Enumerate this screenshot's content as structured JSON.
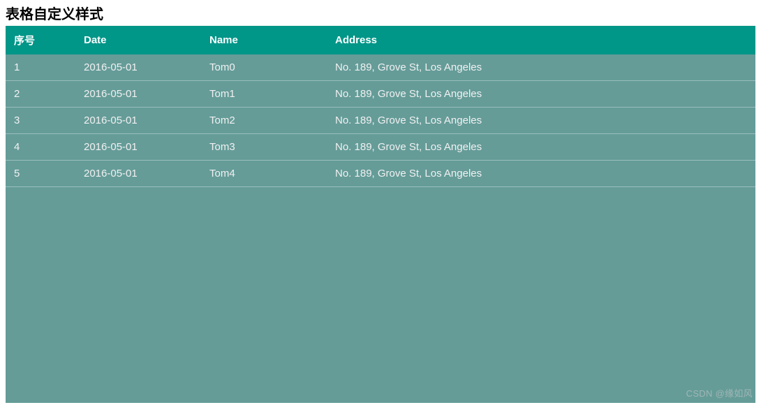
{
  "title": "表格自定义样式",
  "table": {
    "headers": {
      "index": "序号",
      "date": "Date",
      "name": "Name",
      "address": "Address"
    },
    "rows": [
      {
        "index": "1",
        "date": "2016-05-01",
        "name": "Tom0",
        "address": "No. 189, Grove St, Los Angeles"
      },
      {
        "index": "2",
        "date": "2016-05-01",
        "name": "Tom1",
        "address": "No. 189, Grove St, Los Angeles"
      },
      {
        "index": "3",
        "date": "2016-05-01",
        "name": "Tom2",
        "address": "No. 189, Grove St, Los Angeles"
      },
      {
        "index": "4",
        "date": "2016-05-01",
        "name": "Tom3",
        "address": "No. 189, Grove St, Los Angeles"
      },
      {
        "index": "5",
        "date": "2016-05-01",
        "name": "Tom4",
        "address": "No. 189, Grove St, Los Angeles"
      }
    ]
  },
  "watermark": "CSDN @缘如风"
}
